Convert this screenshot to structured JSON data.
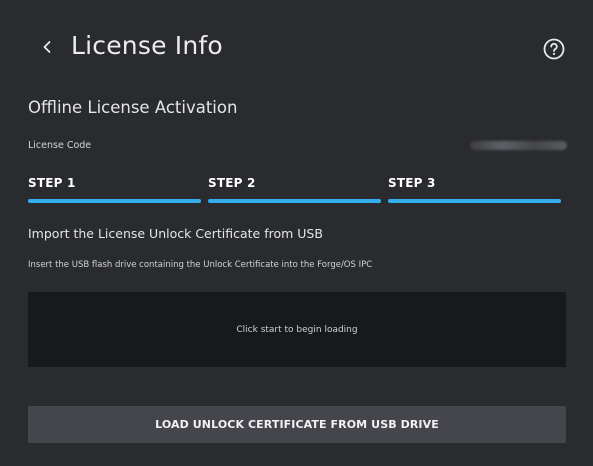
{
  "header": {
    "back_icon": "chevron-left-icon",
    "title": "License Info",
    "help_icon": "help-circle-icon"
  },
  "section": {
    "title": "Offline License Activation"
  },
  "license": {
    "label": "License Code",
    "value_redacted": true
  },
  "steps": [
    {
      "label": "STEP 1",
      "active": true
    },
    {
      "label": "STEP 2",
      "active": true
    },
    {
      "label": "STEP 3",
      "active": true
    }
  ],
  "instruction": {
    "title": "Import the License Unlock Certificate from USB",
    "subtitle": "Insert the USB flash drive containing the Unlock Certificate into the Forge/OS IPC"
  },
  "log_panel": {
    "text": "Click start to begin loading"
  },
  "actions": {
    "load_label": "LOAD UNLOCK CERTIFICATE FROM USB DRIVE"
  },
  "colors": {
    "background": "#2a2b2f",
    "step_accent": "#35aef0",
    "panel": "#18191b",
    "button": "#45464c"
  }
}
